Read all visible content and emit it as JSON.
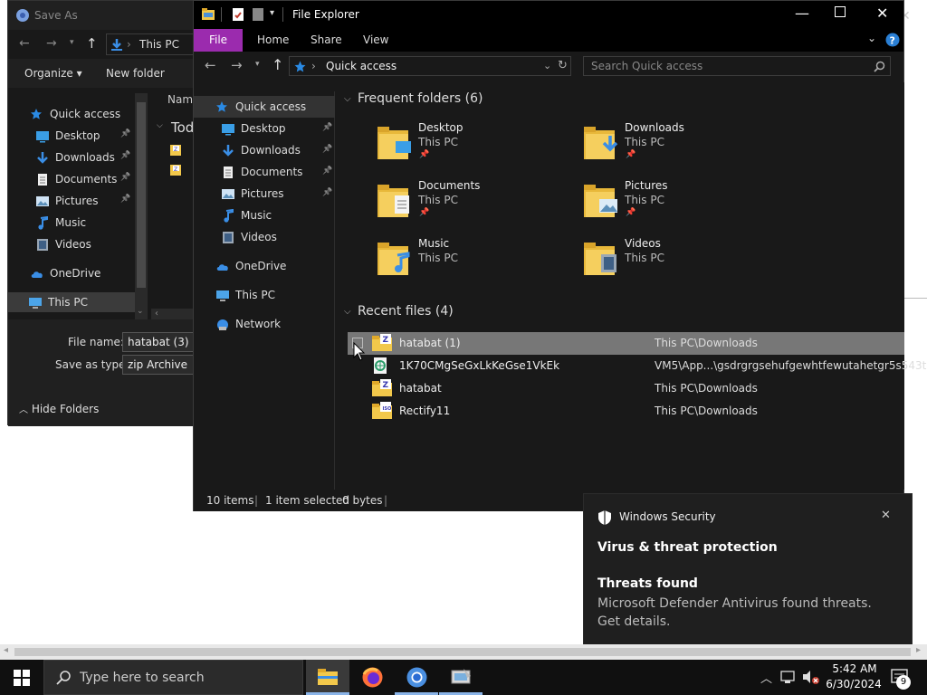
{
  "save_as": {
    "title": "Save As",
    "breadcrumb": "This PC",
    "organize_label": "Organize",
    "new_folder_label": "New folder",
    "column_name": "Name",
    "group_today": "Tod",
    "tree": [
      {
        "label": "Quick access",
        "icon": "star-icon"
      },
      {
        "label": "Desktop",
        "icon": "desktop-icon",
        "pinned": true
      },
      {
        "label": "Downloads",
        "icon": "download-icon",
        "pinned": true
      },
      {
        "label": "Documents",
        "icon": "documents-icon",
        "pinned": true
      },
      {
        "label": "Pictures",
        "icon": "pictures-icon",
        "pinned": true
      },
      {
        "label": "Music",
        "icon": "music-icon"
      },
      {
        "label": "Videos",
        "icon": "videos-icon"
      },
      {
        "label": "OneDrive",
        "icon": "cloud-icon"
      },
      {
        "label": "This PC",
        "icon": "computer-icon"
      }
    ],
    "file_name_label": "File name:",
    "file_name_value": "hatabat (3)",
    "save_type_label": "Save as type:",
    "save_type_value": "zip Archive",
    "hide_folders_label": "Hide Folders"
  },
  "explorer": {
    "title": "File Explorer",
    "ribbon_tabs": [
      "File",
      "Home",
      "Share",
      "View"
    ],
    "address": "Quick access",
    "search_placeholder": "Search Quick access",
    "nav": [
      {
        "label": "Quick access",
        "icon": "star-icon"
      },
      {
        "label": "Desktop",
        "icon": "desktop-icon",
        "pinned": true
      },
      {
        "label": "Downloads",
        "icon": "download-icon",
        "pinned": true
      },
      {
        "label": "Documents",
        "icon": "documents-icon",
        "pinned": true
      },
      {
        "label": "Pictures",
        "icon": "pictures-icon",
        "pinned": true
      },
      {
        "label": "Music",
        "icon": "music-icon"
      },
      {
        "label": "Videos",
        "icon": "videos-icon"
      },
      {
        "label": "OneDrive",
        "icon": "cloud-icon"
      },
      {
        "label": "This PC",
        "icon": "computer-icon"
      },
      {
        "label": "Network",
        "icon": "network-icon"
      }
    ],
    "frequent_header": "Frequent folders (6)",
    "frequent": [
      {
        "name": "Desktop",
        "location": "This PC",
        "pinned": true
      },
      {
        "name": "Downloads",
        "location": "This PC",
        "pinned": true
      },
      {
        "name": "Documents",
        "location": "This PC",
        "pinned": true
      },
      {
        "name": "Pictures",
        "location": "This PC",
        "pinned": true
      },
      {
        "name": "Music",
        "location": "This PC",
        "pinned": false
      },
      {
        "name": "Videos",
        "location": "This PC",
        "pinned": false
      }
    ],
    "recent_header": "Recent files (4)",
    "recent": [
      {
        "name": "hatabat (1)",
        "path": "This PC\\Downloads",
        "selected": true
      },
      {
        "name": "1K70CMgSeGxLkKeGse1VkEk",
        "path": "VM5\\App...\\gsdrgrgsehufgewhtfewutahetgr5s543t",
        "selected": false
      },
      {
        "name": "hatabat",
        "path": "This PC\\Downloads",
        "selected": false
      },
      {
        "name": "Rectify11",
        "path": "This PC\\Downloads",
        "selected": false
      }
    ],
    "status": {
      "items": "10 items",
      "selected": "1 item selected",
      "size": "0 bytes"
    }
  },
  "toast": {
    "app": "Windows Security",
    "heading": "Virus & threat protection",
    "subheading": "Threats found",
    "body": "Microsoft Defender Antivirus found threats. Get details."
  },
  "taskbar": {
    "search_placeholder": "Type here to search",
    "time": "5:42 AM",
    "date": "6/30/2024",
    "notification_count": "9"
  },
  "colors": {
    "accent": "#0078d7",
    "file_tab": "#9b2bae",
    "selection": "#777777",
    "folder": "#f2c84b"
  }
}
